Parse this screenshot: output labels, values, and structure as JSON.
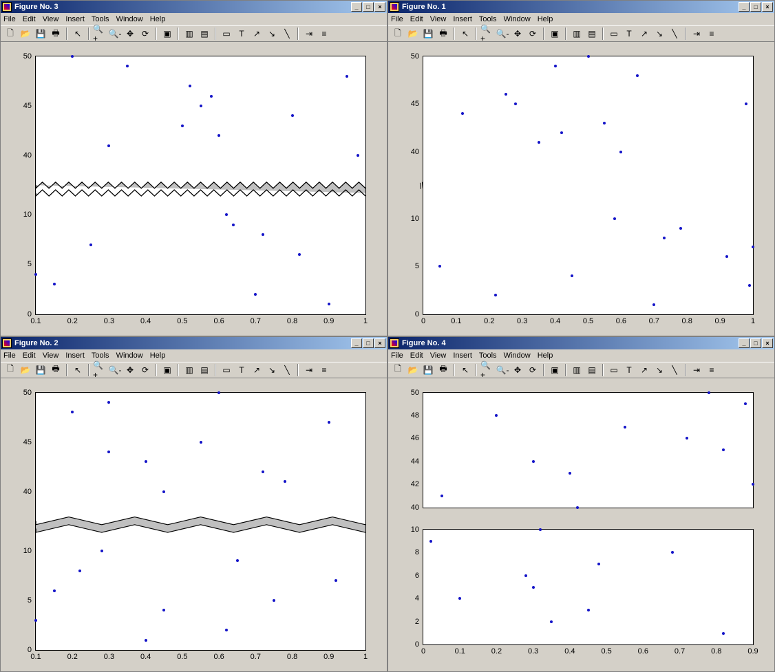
{
  "menus": [
    "File",
    "Edit",
    "View",
    "Insert",
    "Tools",
    "Window",
    "Help"
  ],
  "toolbar_icons": [
    {
      "name": "new-icon",
      "glyph": "🗋"
    },
    {
      "name": "open-icon",
      "glyph": "📂"
    },
    {
      "name": "save-icon",
      "glyph": "💾"
    },
    {
      "name": "print-icon",
      "glyph": "🖶"
    },
    {
      "sep": true
    },
    {
      "name": "pointer-icon",
      "glyph": "↖"
    },
    {
      "sep": true
    },
    {
      "name": "zoom-in-icon",
      "glyph": "🔍+"
    },
    {
      "name": "zoom-out-icon",
      "glyph": "🔍-"
    },
    {
      "name": "pan-icon",
      "glyph": "✥"
    },
    {
      "name": "rotate-icon",
      "glyph": "⟳"
    },
    {
      "sep": true
    },
    {
      "name": "data-cursor-icon",
      "glyph": "▣"
    },
    {
      "sep": true
    },
    {
      "name": "colorbar-icon",
      "glyph": "▥"
    },
    {
      "name": "legend-icon",
      "glyph": "▤"
    },
    {
      "sep": true
    },
    {
      "name": "rect-icon",
      "glyph": "▭"
    },
    {
      "name": "text-icon",
      "glyph": "T"
    },
    {
      "name": "arrow2-icon",
      "glyph": "↗"
    },
    {
      "name": "arrow-icon",
      "glyph": "↘"
    },
    {
      "name": "line-icon",
      "glyph": "╲"
    },
    {
      "sep": true
    },
    {
      "name": "align-icon",
      "glyph": "⇥"
    },
    {
      "name": "props-icon",
      "glyph": "≡"
    }
  ],
  "window_buttons": {
    "minimize": "_",
    "maximize": "□",
    "close": "×"
  },
  "figures": {
    "topleft": {
      "title": "Figure No. 3"
    },
    "topright": {
      "title": "Figure No. 1"
    },
    "bottomleft": {
      "title": "Figure No. 2"
    },
    "bottomright": {
      "title": "Figure No. 4"
    }
  },
  "chart_data": [
    {
      "id": "fig3",
      "type": "scatter",
      "xlim": [
        0.1,
        1.0
      ],
      "ylim": [
        0,
        50
      ],
      "xticks": [
        0.1,
        0.2,
        0.3,
        0.4,
        0.5,
        0.6,
        0.7,
        0.8,
        0.9,
        1.0
      ],
      "yticks": [
        0,
        5,
        10,
        40,
        45,
        50
      ],
      "axis_break": {
        "from": 11,
        "to": 38,
        "style": "zigzag"
      },
      "points": [
        [
          0.1,
          4
        ],
        [
          0.15,
          3
        ],
        [
          0.2,
          50
        ],
        [
          0.25,
          7
        ],
        [
          0.3,
          41
        ],
        [
          0.35,
          49
        ],
        [
          0.5,
          43
        ],
        [
          0.52,
          47
        ],
        [
          0.55,
          45
        ],
        [
          0.58,
          46
        ],
        [
          0.6,
          42
        ],
        [
          0.62,
          10
        ],
        [
          0.64,
          9
        ],
        [
          0.7,
          2
        ],
        [
          0.72,
          8
        ],
        [
          0.8,
          44
        ],
        [
          0.82,
          6
        ],
        [
          0.9,
          1
        ],
        [
          0.95,
          48
        ],
        [
          0.98,
          40
        ]
      ]
    },
    {
      "id": "fig1",
      "type": "scatter",
      "xlim": [
        0,
        1.0
      ],
      "ylim": [
        0,
        50
      ],
      "xticks": [
        0,
        0.1,
        0.2,
        0.3,
        0.4,
        0.5,
        0.6,
        0.7,
        0.8,
        0.9,
        1.0
      ],
      "yticks": [
        0,
        5,
        10,
        40,
        45,
        50
      ],
      "axis_break": {
        "from": 12,
        "to": 38,
        "style": "slash"
      },
      "points": [
        [
          0.05,
          5
        ],
        [
          0.12,
          44
        ],
        [
          0.22,
          2
        ],
        [
          0.25,
          46
        ],
        [
          0.28,
          45
        ],
        [
          0.35,
          41
        ],
        [
          0.4,
          49
        ],
        [
          0.42,
          42
        ],
        [
          0.45,
          4
        ],
        [
          0.5,
          50
        ],
        [
          0.55,
          43
        ],
        [
          0.58,
          10
        ],
        [
          0.6,
          40
        ],
        [
          0.65,
          48
        ],
        [
          0.7,
          1
        ],
        [
          0.73,
          8
        ],
        [
          0.78,
          9
        ],
        [
          0.92,
          6
        ],
        [
          0.98,
          45
        ],
        [
          0.99,
          3
        ],
        [
          1.0,
          7
        ]
      ]
    },
    {
      "id": "fig2",
      "type": "scatter",
      "xlim": [
        0.1,
        1.0
      ],
      "ylim": [
        0,
        50
      ],
      "xticks": [
        0.1,
        0.2,
        0.3,
        0.4,
        0.5,
        0.6,
        0.7,
        0.8,
        0.9,
        1.0
      ],
      "yticks": [
        0,
        5,
        10,
        40,
        45,
        50
      ],
      "axis_break": {
        "from": 11,
        "to": 38,
        "style": "wave"
      },
      "points": [
        [
          0.1,
          3
        ],
        [
          0.15,
          6
        ],
        [
          0.2,
          48
        ],
        [
          0.22,
          8
        ],
        [
          0.28,
          10
        ],
        [
          0.3,
          49
        ],
        [
          0.3,
          44
        ],
        [
          0.4,
          1
        ],
        [
          0.4,
          43
        ],
        [
          0.45,
          40
        ],
        [
          0.45,
          4
        ],
        [
          0.55,
          45
        ],
        [
          0.6,
          50
        ],
        [
          0.62,
          2
        ],
        [
          0.65,
          9
        ],
        [
          0.72,
          42
        ],
        [
          0.75,
          5
        ],
        [
          0.78,
          41
        ],
        [
          0.9,
          47
        ],
        [
          0.92,
          7
        ]
      ]
    },
    {
      "id": "fig4_top",
      "type": "scatter",
      "xlim": [
        0.0,
        0.9
      ],
      "ylim": [
        40,
        50
      ],
      "xticks": [],
      "yticks": [
        40,
        42,
        44,
        46,
        48,
        50
      ],
      "points": [
        [
          0.05,
          41
        ],
        [
          0.2,
          48
        ],
        [
          0.3,
          44
        ],
        [
          0.4,
          43
        ],
        [
          0.42,
          40
        ],
        [
          0.55,
          47
        ],
        [
          0.72,
          46
        ],
        [
          0.78,
          50
        ],
        [
          0.82,
          45
        ],
        [
          0.88,
          49
        ],
        [
          0.9,
          42
        ]
      ]
    },
    {
      "id": "fig4_bot",
      "type": "scatter",
      "xlim": [
        0.0,
        0.9
      ],
      "ylim": [
        0,
        10
      ],
      "xticks": [
        0,
        0.1,
        0.2,
        0.3,
        0.4,
        0.5,
        0.6,
        0.7,
        0.8,
        0.9
      ],
      "yticks": [
        0,
        2,
        4,
        6,
        8,
        10
      ],
      "points": [
        [
          0.02,
          9
        ],
        [
          0.1,
          4
        ],
        [
          0.28,
          6
        ],
        [
          0.3,
          5
        ],
        [
          0.32,
          10
        ],
        [
          0.35,
          2
        ],
        [
          0.45,
          3
        ],
        [
          0.48,
          7
        ],
        [
          0.68,
          8
        ],
        [
          0.82,
          1
        ]
      ]
    }
  ]
}
